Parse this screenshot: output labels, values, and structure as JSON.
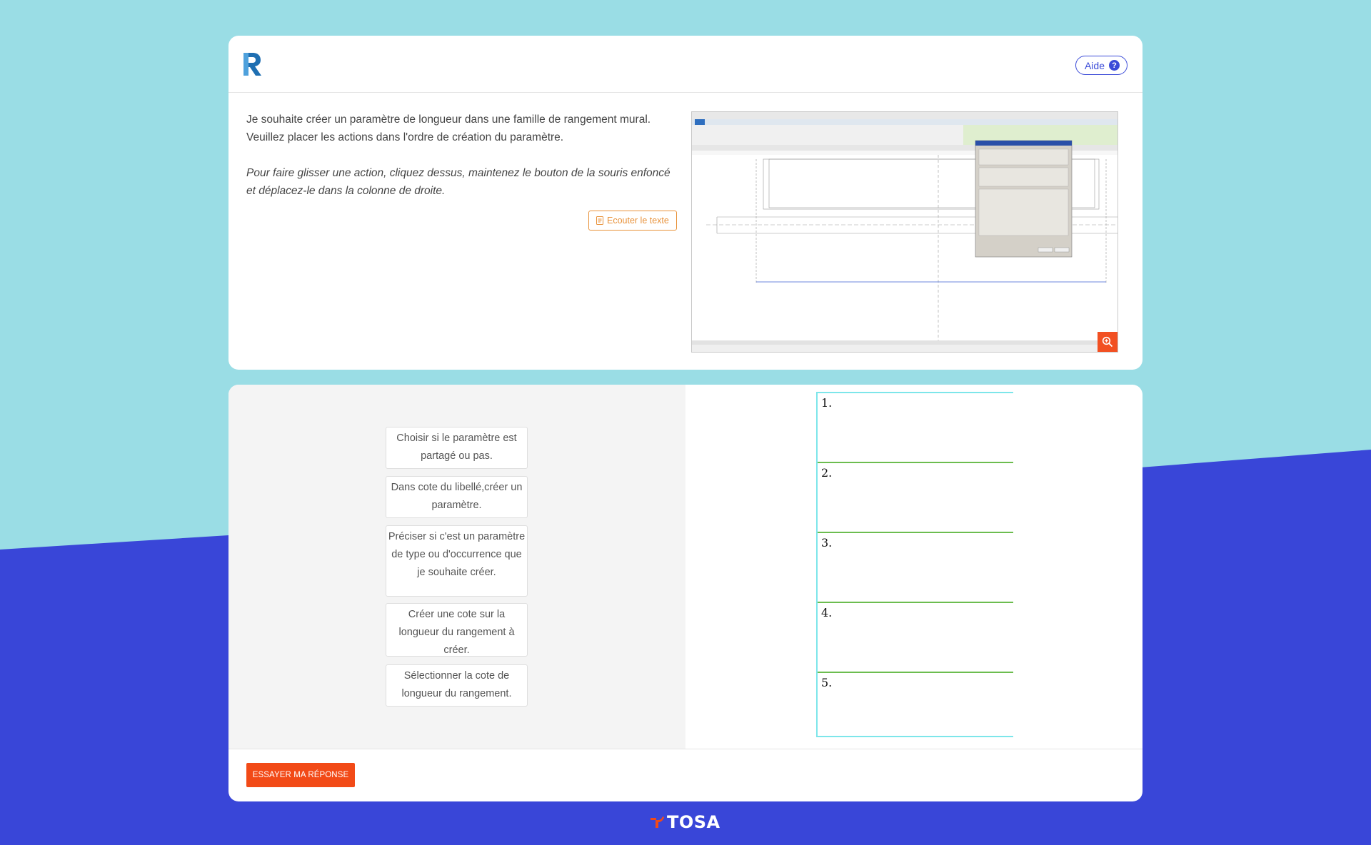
{
  "colors": {
    "background_light": "#9adde5",
    "background_dark": "#3946d8",
    "accent_orange": "#f24a17",
    "help_blue": "#3b4bd8",
    "slot_border": "#7de6ea",
    "slot_separator": "#6cbd4f"
  },
  "header": {
    "logo_icon": "revit-logo-icon",
    "help_label": "Aide",
    "help_icon": "question-circle-icon"
  },
  "question": {
    "line1": "Je souhaite créer un paramètre de longueur dans une famille de rangement mural.",
    "line2": "Veuillez placer les actions dans l'ordre de création du paramètre.",
    "instructions": "Pour faire glisser une action, cliquez dessus, maintenez le bouton de la souris enfoncé et déplacez-le dans la colonne de droite.",
    "listen_label": "Ecouter le texte",
    "listen_icon": "document-audio-icon",
    "zoom_icon": "zoom-in-icon"
  },
  "actions": [
    "Choisir si le paramètre est partagé ou pas.",
    "Dans cote du libellé,créer un paramètre.",
    "Préciser si c'est un paramètre de type ou d'occurrence que je souhaite créer.",
    "Créer une cote sur la longueur du rangement à créer.",
    "Sélectionner la cote de longueur du rangement."
  ],
  "slots": [
    "1.",
    "2.",
    "3.",
    "4.",
    "5."
  ],
  "footer": {
    "submit_label": "ESSAYER MA RÉPONSE",
    "brand": "TOSA"
  }
}
